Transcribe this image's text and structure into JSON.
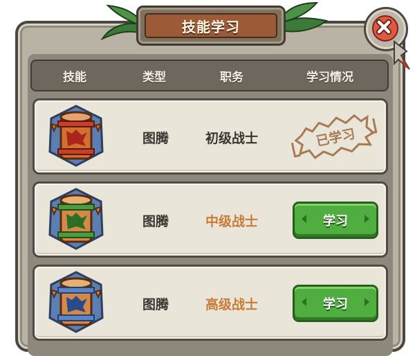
{
  "dialog": {
    "title": "技能学习"
  },
  "header": {
    "col_skill": "技能",
    "col_type": "类型",
    "col_role": "职务",
    "col_status": "学习情况"
  },
  "rows": [
    {
      "icon": "totem-red-icon",
      "type": "图腾",
      "role": "初级战士",
      "role_color": "#3a3631",
      "status": "已学习"
    },
    {
      "icon": "totem-green-icon",
      "type": "图腾",
      "role": "中级战士",
      "role_color": "#c97b38",
      "action_label": "学习"
    },
    {
      "icon": "totem-blue-icon",
      "type": "图腾",
      "role": "高级战士",
      "role_color": "#c97b38",
      "action_label": "学习"
    }
  ],
  "colors": {
    "learn_button": "#4fae3f",
    "close_button": "#e05840",
    "title_plaque": "#9b5b36"
  }
}
